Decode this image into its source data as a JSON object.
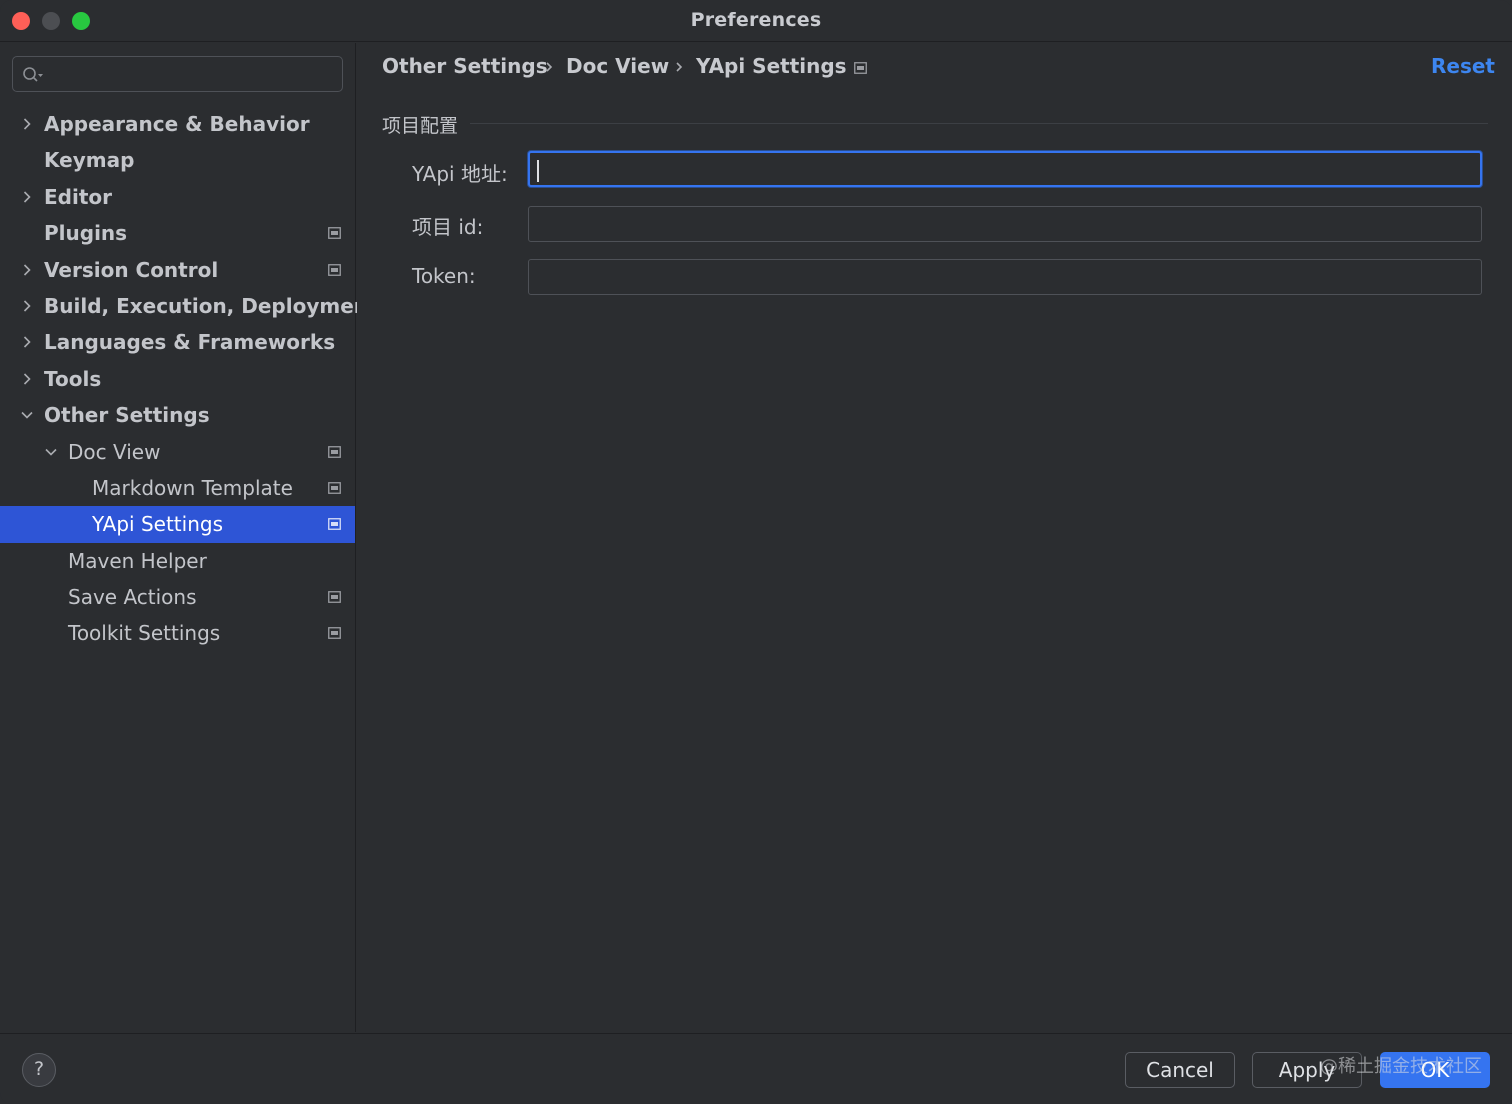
{
  "window": {
    "title": "Preferences"
  },
  "sidebar": {
    "search": {
      "value": "",
      "placeholder": ""
    },
    "items": [
      {
        "label": "Appearance & Behavior",
        "level": 0,
        "expander": "collapsed",
        "bold": true,
        "badge": false,
        "selected": false
      },
      {
        "label": "Keymap",
        "level": 0,
        "expander": "none",
        "bold": true,
        "badge": false,
        "selected": false
      },
      {
        "label": "Editor",
        "level": 0,
        "expander": "collapsed",
        "bold": true,
        "badge": false,
        "selected": false
      },
      {
        "label": "Plugins",
        "level": 0,
        "expander": "none",
        "bold": true,
        "badge": true,
        "selected": false
      },
      {
        "label": "Version Control",
        "level": 0,
        "expander": "collapsed",
        "bold": true,
        "badge": true,
        "selected": false
      },
      {
        "label": "Build, Execution, Deployment",
        "level": 0,
        "expander": "collapsed",
        "bold": true,
        "badge": false,
        "selected": false
      },
      {
        "label": "Languages & Frameworks",
        "level": 0,
        "expander": "collapsed",
        "bold": true,
        "badge": false,
        "selected": false
      },
      {
        "label": "Tools",
        "level": 0,
        "expander": "collapsed",
        "bold": true,
        "badge": false,
        "selected": false
      },
      {
        "label": "Other Settings",
        "level": 0,
        "expander": "expanded",
        "bold": true,
        "badge": false,
        "selected": false
      },
      {
        "label": "Doc View",
        "level": 1,
        "expander": "expanded",
        "bold": false,
        "badge": true,
        "selected": false
      },
      {
        "label": "Markdown Template",
        "level": 2,
        "expander": "none",
        "bold": false,
        "badge": true,
        "selected": false
      },
      {
        "label": "YApi Settings",
        "level": 2,
        "expander": "none",
        "bold": false,
        "badge": true,
        "selected": true
      },
      {
        "label": "Maven Helper",
        "level": 1,
        "expander": "none",
        "bold": false,
        "badge": false,
        "selected": false
      },
      {
        "label": "Save Actions",
        "level": 1,
        "expander": "none",
        "bold": false,
        "badge": true,
        "selected": false
      },
      {
        "label": "Toolkit Settings",
        "level": 1,
        "expander": "none",
        "bold": false,
        "badge": true,
        "selected": false
      }
    ]
  },
  "main": {
    "breadcrumb": [
      "Other Settings",
      "Doc View",
      "YApi Settings"
    ],
    "reset_label": "Reset",
    "group_title": "项目配置",
    "fields": [
      {
        "label": "YApi 地址:",
        "value": "",
        "focused": true
      },
      {
        "label": "项目 id:",
        "value": "",
        "focused": false
      },
      {
        "label": "Token:",
        "value": "",
        "focused": false
      }
    ]
  },
  "footer": {
    "help_label": "?",
    "cancel_label": "Cancel",
    "apply_label": "Apply",
    "ok_label": "OK"
  },
  "watermark": "@稀土掘金技术社区",
  "colors": {
    "background": "#2b2d30",
    "selection": "#2e55d6",
    "accent": "#3574f0",
    "link": "#3d86f0",
    "close": "#fe5f57",
    "maximize": "#28c840"
  }
}
